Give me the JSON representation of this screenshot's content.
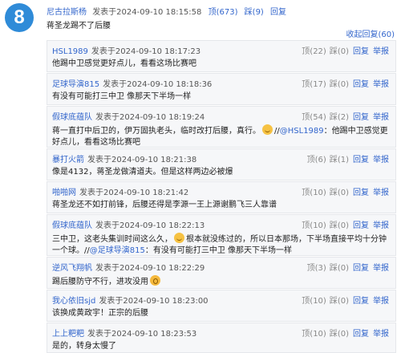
{
  "main": {
    "floor": "8",
    "author": "尼古拉斯杨",
    "posted": "发表于2024-09-10 18:15:58",
    "up": "顶(673)",
    "down": "踩(9)",
    "reply": "回复",
    "content": "蒋圣龙踢不了后腰",
    "collapse": "收起回复(60)"
  },
  "replies": [
    {
      "author": "HSL1989",
      "posted": "发表于2024-09-10 18:17:23",
      "up": "顶(22)",
      "down": "踩(0)",
      "reply": "回复",
      "report": "举报",
      "content": "他踢中卫感觉更好点儿，看看这场比赛吧"
    },
    {
      "author": "足球导演815",
      "posted": "发表于2024-09-10 18:18:36",
      "up": "顶(17)",
      "down": "踩(0)",
      "reply": "回复",
      "report": "举报",
      "content": "有没有可能打三中卫 像那天下半场一样"
    },
    {
      "author": "假球底蕴队",
      "posted": "发表于2024-09-10 18:19:24",
      "up": "顶(54)",
      "down": "踩(2)",
      "reply": "回复",
      "report": "举报",
      "content": "蒋一直打中后卫的，伊万固执老头，临时改打后腰，真行。",
      "mention_prefix": "//",
      "mention": "@HSL1989",
      "content_after": "：他踢中卫感觉更好点儿，看看这场比赛吧"
    },
    {
      "author": "暴打火箭",
      "posted": "发表于2024-09-10 18:21:38",
      "up": "顶(6)",
      "down": "踩(1)",
      "reply": "回复",
      "report": "举报",
      "content": "像是4132，蒋圣龙做清道夫。但是这样两边必被爆"
    },
    {
      "author": "啪啪网",
      "posted": "发表于2024-09-10 18:21:42",
      "up": "顶(10)",
      "down": "踩(0)",
      "reply": "回复",
      "report": "举报",
      "content": "蒋圣龙还不如打前锋，后腰还得是李源一王上源谢鹏飞三人靠谱"
    },
    {
      "author": "假球底蕴队",
      "posted": "发表于2024-09-10 18:22:13",
      "up": "顶(10)",
      "down": "踩(0)",
      "reply": "回复",
      "report": "举报",
      "content": "三中卫，这老头集训时间这么久，",
      "content_after": "根本就没练过的，所以日本那场，下半场直接平均十分钟一个球。",
      "mention_prefix": "//",
      "mention": "@足球导演815",
      "content_end": "：有没有可能打三中卫 像那天下半场一样"
    },
    {
      "author": "逆风飞翔帆",
      "posted": "发表于2024-09-10 18:22:29",
      "up": "顶(3)",
      "down": "踩(0)",
      "reply": "回复",
      "report": "举报",
      "content": "踢后腰防守不行，进攻没用"
    },
    {
      "author": "我心依旧sjd",
      "posted": "发表于2024-09-10 18:23:00",
      "up": "顶(10)",
      "down": "踩(0)",
      "reply": "回复",
      "report": "举报",
      "content": "该换成黄政宇！正宗的后腰"
    },
    {
      "author": "上上粑粑",
      "posted": "发表于2024-09-10 18:23:53",
      "up": "顶(10)",
      "down": "踩(0)",
      "reply": "回复",
      "report": "举报",
      "content": "是的，转身太慢了"
    }
  ]
}
